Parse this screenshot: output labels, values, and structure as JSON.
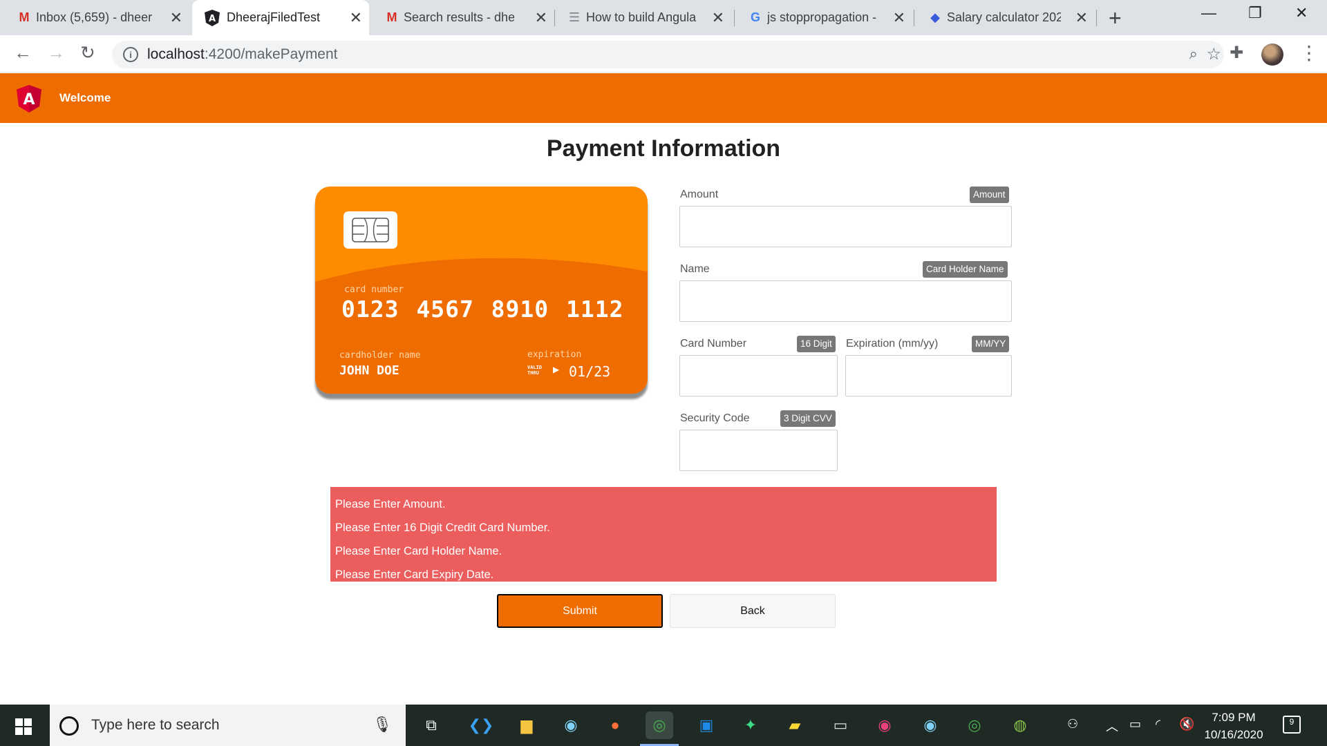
{
  "browser": {
    "tabs": [
      {
        "title": "Inbox (5,659) - dheer",
        "icon": "gmail-icon",
        "active": false
      },
      {
        "title": "DheerajFiledTest",
        "icon": "angular-icon",
        "active": true
      },
      {
        "title": "Search results - dhee",
        "icon": "gmail-icon",
        "active": false
      },
      {
        "title": "How to build Angula",
        "icon": "document-icon",
        "active": false
      },
      {
        "title": "js stoppropagation -",
        "icon": "google-icon",
        "active": false
      },
      {
        "title": "Salary calculator 202",
        "icon": "shield-icon",
        "active": false
      }
    ],
    "url_host": "localhost",
    "url_path": ":4200/makePayment",
    "close_glyph": "✕",
    "new_tab_glyph": "+"
  },
  "app": {
    "header_title": "Welcome",
    "logo_letter": "A",
    "brand_color": "#ef6c00"
  },
  "page": {
    "title": "Payment Information"
  },
  "card": {
    "number_label": "card number",
    "number": "0123 4567 8910 1112",
    "holder_label": "cardholder name",
    "holder": "JOHN DOE",
    "expiration_label": "expiration",
    "valid_thru": "VALID THRU",
    "expiration": "01/23"
  },
  "form": {
    "amount": {
      "label": "Amount",
      "badge": "Amount",
      "value": ""
    },
    "name": {
      "label": "Name",
      "badge": "Card Holder Name",
      "value": ""
    },
    "card_number": {
      "label": "Card Number",
      "badge": "16 Digit",
      "value": ""
    },
    "expiration": {
      "label": "Expiration (mm/yy)",
      "badge": "MM/YY",
      "value": ""
    },
    "security_code": {
      "label": "Security Code",
      "badge": "3 Digit CVV",
      "value": ""
    }
  },
  "errors": [
    "Please Enter Amount.",
    "Please Enter 16 Digit Credit Card Number.",
    "Please Enter Card Holder Name.",
    "Please Enter Card Expiry Date."
  ],
  "buttons": {
    "submit": "Submit",
    "back": "Back"
  },
  "taskbar": {
    "search_placeholder": "Type here to search",
    "time": "7:09 PM",
    "date": "10/16/2020",
    "notification_count": "9",
    "apps": [
      "task-view-icon",
      "vscode-icon",
      "file-explorer-icon",
      "app-icon",
      "firefox-icon",
      "chrome-icon",
      "outlook-icon",
      "android-studio-icon",
      "sticky-notes-icon",
      "terminal-icon",
      "app-icon",
      "app-icon",
      "chrome-icon",
      "globe-icon"
    ]
  }
}
